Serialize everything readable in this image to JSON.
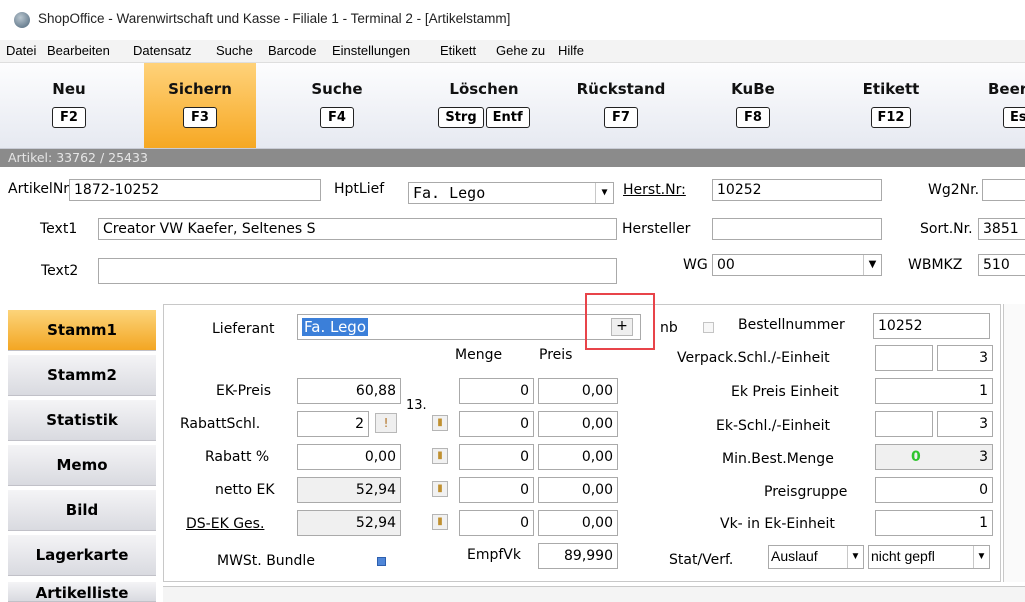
{
  "window": {
    "title": "ShopOffice - Warenwirtschaft und Kasse - Filiale 1 - Terminal 2 - [Artikelstamm]"
  },
  "menu": [
    "Datei",
    "Bearbeiten",
    "Datensatz",
    "Suche",
    "Barcode",
    "Einstellungen",
    "Etikett",
    "Gehe zu",
    "Hilfe"
  ],
  "toolbar": {
    "neu": {
      "label": "Neu",
      "keys": [
        "F2"
      ]
    },
    "sichern": {
      "label": "Sichern",
      "keys": [
        "F3"
      ]
    },
    "suche": {
      "label": "Suche",
      "keys": [
        "F4"
      ]
    },
    "loeschen": {
      "label": "Löschen",
      "keys": [
        "Strg",
        "Entf"
      ]
    },
    "rueckstand": {
      "label": "Rückstand",
      "keys": [
        "F7"
      ]
    },
    "kube": {
      "label": "KuBe",
      "keys": [
        "F8"
      ]
    },
    "etikett": {
      "label": "Etikett",
      "keys": [
        "F12"
      ]
    },
    "beenden": {
      "label": "Beer",
      "keys": [
        "Es"
      ]
    }
  },
  "artikel_info": "Artikel: 33762 / 25433",
  "header_form": {
    "artikelnr_label": "ArtikelNr",
    "artikelnr": "1872-10252",
    "hptlief_label": "HptLief",
    "hptlief": "Fa. Lego",
    "herst_nr_label": "Herst.Nr:",
    "herst_nr": "10252",
    "wg2nr_label": "Wg2Nr.",
    "wg2nr": "",
    "text1_label": "Text1",
    "text1": "Creator VW Kaefer, Seltenes S",
    "hersteller_label": "Hersteller",
    "hersteller": "",
    "sort_nr_label": "Sort.Nr.",
    "sort_nr": "3851",
    "text2_label": "Text2",
    "text2": "",
    "wg_label": "WG",
    "wg": "00",
    "wbmkz_label": "WBMKZ",
    "wbmkz": "510"
  },
  "nav": {
    "stamm1": "Stamm1",
    "stamm2": "Stamm2",
    "statistik": "Statistik",
    "memo": "Memo",
    "bild": "Bild",
    "lagerkarte": "Lagerkarte",
    "artikelliste": "Artikelliste"
  },
  "stamm1": {
    "lieferant_label": "Lieferant",
    "lieferant": "Fa. Lego",
    "add_glyph": "+",
    "ek_preis_label": "EK-Preis",
    "ek_preis": "60,88",
    "rabattschl_label": "RabattSchl.",
    "rabattschl": "2",
    "rabatt_btn": "!",
    "rabatt_label": "Rabatt %",
    "rabatt": "0,00",
    "netto_ek_label": "netto EK",
    "netto_ek": "52,94",
    "ds_ek_label": "DS-EK Ges.",
    "ds_ek": "52,94",
    "mwst_bundle_label": "MWSt. Bundle",
    "tier_marker": "13.",
    "menge_header": "Menge",
    "preis_header": "Preis",
    "staffel": [
      {
        "menge": "0",
        "preis": "0,00"
      },
      {
        "menge": "0",
        "preis": "0,00"
      },
      {
        "menge": "0",
        "preis": "0,00"
      },
      {
        "menge": "0",
        "preis": "0,00"
      },
      {
        "menge": "0",
        "preis": "0,00"
      }
    ],
    "empfvk_label": "EmpfVk",
    "empfvk": "89,990",
    "nb_label": "nb",
    "bestellnummer_label": "Bestellnummer",
    "bestellnummer": "10252",
    "verpack_label": "Verpack.Schl./-Einheit",
    "verpack_schl": "",
    "verpack_einheit": "3",
    "ek_preis_einheit_label": "Ek Preis Einheit",
    "ek_preis_einheit": "1",
    "ek_schl_label": "Ek-Schl./-Einheit",
    "ek_schl": "",
    "ek_einheit": "3",
    "min_best_label": "Min.Best.Menge",
    "min_best_indicator": "0",
    "min_best": "3",
    "preisgruppe_label": "Preisgruppe",
    "preisgruppe": "0",
    "vk_ek_label": "Vk- in Ek-Einheit",
    "vk_ek": "1",
    "stat_verf_label": "Stat/Verf.",
    "stat": "Auslauf",
    "verf": "nicht gepfl"
  },
  "colors": {
    "active_orange": "#f6a823",
    "highlight_red": "#e8444a",
    "indicator_green": "#2fc52f",
    "selection_blue": "#3b7fd9"
  }
}
